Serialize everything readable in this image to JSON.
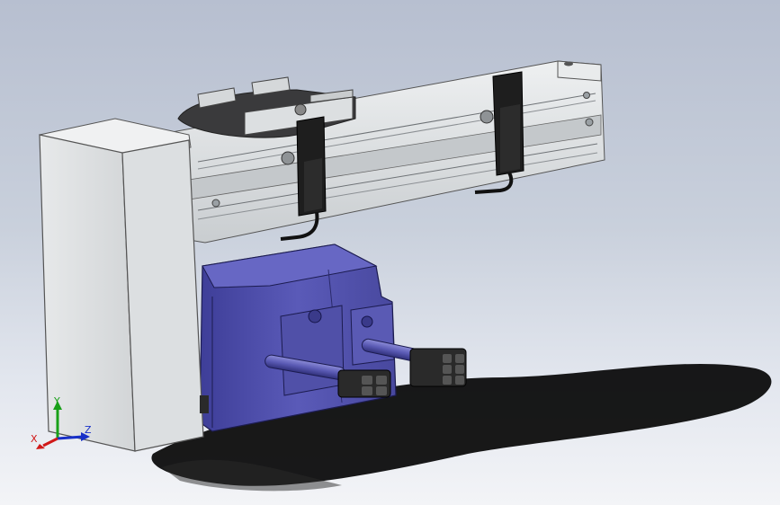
{
  "view": {
    "background_top": "#b7bfd0",
    "background_bottom": "#f3f4f7"
  },
  "model": {
    "housing_color": "#e3e5e6",
    "rail_color": "#d7dadc",
    "motor_color": "#5a5ab4",
    "sensor_color": "#1c1c1c",
    "shadow_color": "#000000"
  },
  "triad": {
    "x_label": "X",
    "y_label": "Y",
    "z_label": "Z",
    "x_color": "#d01818",
    "y_color": "#18a018",
    "z_color": "#1830c8"
  }
}
